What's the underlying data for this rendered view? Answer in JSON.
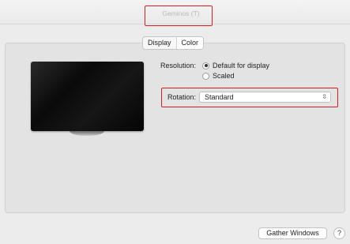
{
  "window": {
    "title": "Geminos (T)"
  },
  "tabs": [
    {
      "label": "Display",
      "active": false
    },
    {
      "label": "Color",
      "active": true
    }
  ],
  "display": {
    "resolution_label": "Resolution:",
    "resolution_options": [
      {
        "label": "Default for display",
        "selected": true
      },
      {
        "label": "Scaled",
        "selected": false
      }
    ],
    "rotation_label": "Rotation:",
    "rotation_value": "Standard"
  },
  "footer": {
    "gather_windows_label": "Gather Windows",
    "help_label": "?"
  },
  "colors": {
    "highlight": "#d42020"
  }
}
